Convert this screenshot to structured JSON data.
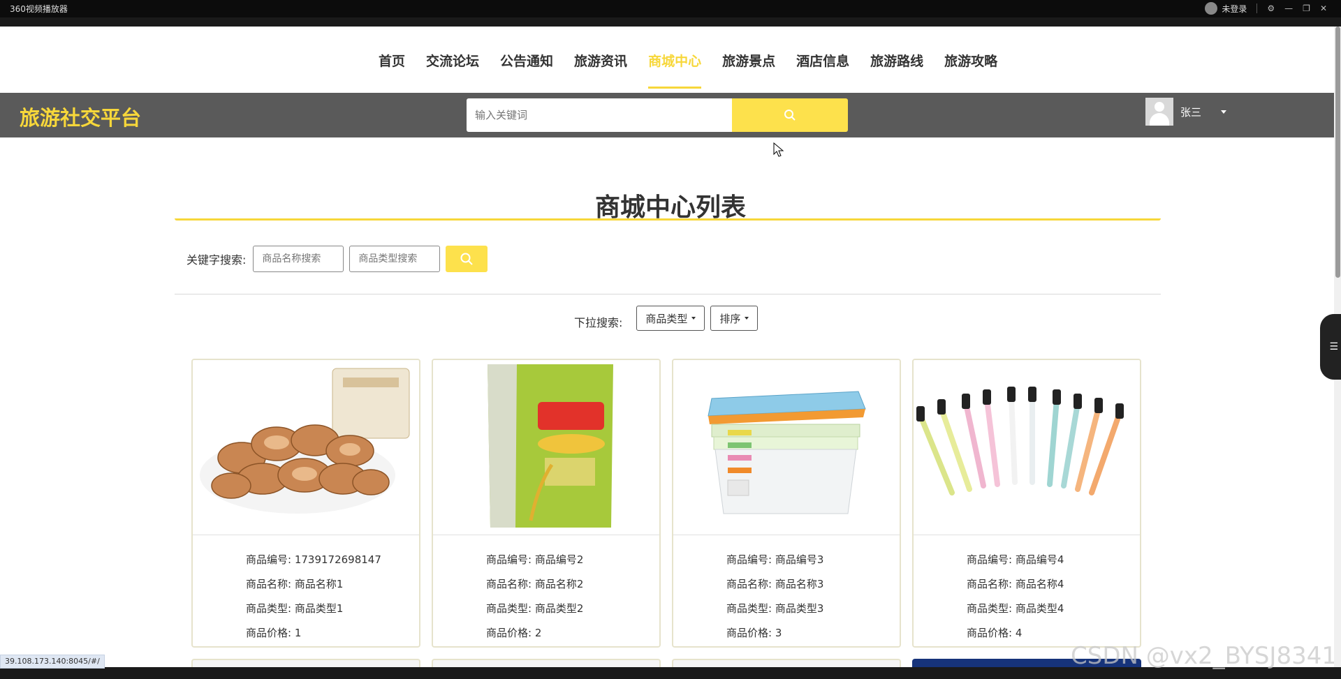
{
  "player": {
    "title": "360视频播放器",
    "user": "未登录"
  },
  "nav": {
    "items": [
      "首页",
      "交流论坛",
      "公告通知",
      "旅游资讯",
      "商城中心",
      "旅游景点",
      "酒店信息",
      "旅游路线",
      "旅游攻略"
    ],
    "active_index": 4
  },
  "header": {
    "brand": "旅游社交平台",
    "search_placeholder": "输入关键词",
    "user_name": "张三"
  },
  "main": {
    "title": "商城中心列表",
    "keyword_label": "关键字搜索:",
    "name_placeholder": "商品名称搜索",
    "type_placeholder": "商品类型搜索",
    "dropdown_label": "下拉搜索:",
    "type_dropdown": "商品类型",
    "sort_dropdown": "排序"
  },
  "labels": {
    "code": "商品编号: ",
    "name": "商品名称: ",
    "type": "商品类型: ",
    "price": "商品价格: "
  },
  "products": [
    {
      "code": "1739172698147",
      "name": "商品名称1",
      "type": "商品类型1",
      "price": "1",
      "image": "almonds"
    },
    {
      "code": "商品编号2",
      "name": "商品名称2",
      "type": "商品类型2",
      "price": "2",
      "image": "rice-bag"
    },
    {
      "code": "商品编号3",
      "name": "商品名称3",
      "type": "商品类型3",
      "price": "3",
      "image": "storage-boxes"
    },
    {
      "code": "商品编号4",
      "name": "商品名称4",
      "type": "商品类型4",
      "price": "4",
      "image": "toothbrushes"
    }
  ],
  "status_url": "39.108.173.140:8045/#/",
  "watermark": "CSDN @vx2_BYSJ8341",
  "colors": {
    "accent": "#f7d73a",
    "header_bg": "#5a5a5a",
    "button": "#fde14c"
  }
}
